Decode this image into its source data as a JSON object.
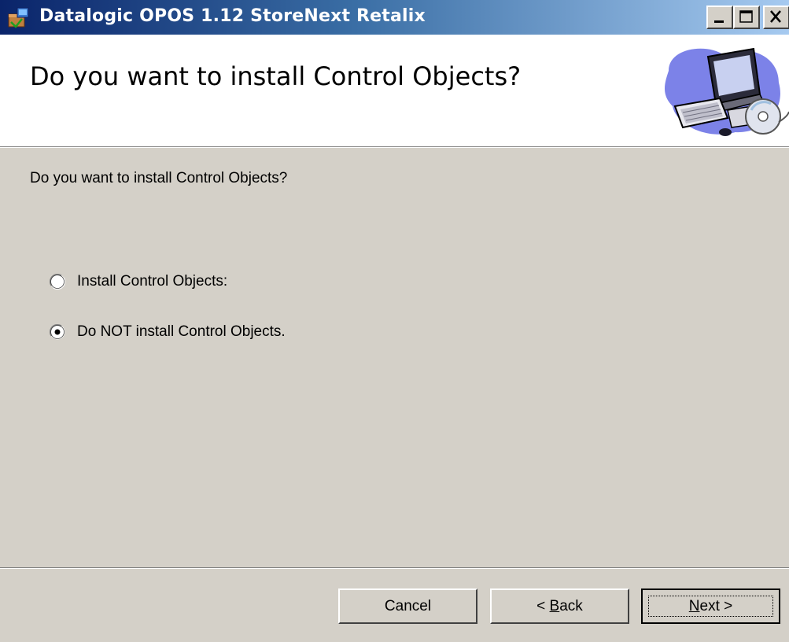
{
  "window": {
    "title": "Datalogic OPOS 1.12 StoreNext Retalix",
    "icon": "installer-icon",
    "controls": [
      "minimize-icon",
      "maximize-icon",
      "close-icon"
    ]
  },
  "header": {
    "title": "Do you want to install Control Objects?",
    "image": "computer-icon"
  },
  "body": {
    "question": "Do you want to install Control Objects?",
    "options": [
      {
        "label": "Install Control Objects:",
        "selected": false
      },
      {
        "label": "Do NOT install Control Objects.",
        "selected": true
      }
    ]
  },
  "buttons": {
    "cancel": "Cancel",
    "back_prefix": "< ",
    "back_key": "B",
    "back_rest": "ack",
    "next_key": "N",
    "next_rest": "ext >"
  },
  "colors": {
    "titlebar_start": "#0a246a",
    "titlebar_end": "#a6caf0",
    "dialog_bg": "#d4d0c8",
    "header_bg": "#ffffff"
  }
}
